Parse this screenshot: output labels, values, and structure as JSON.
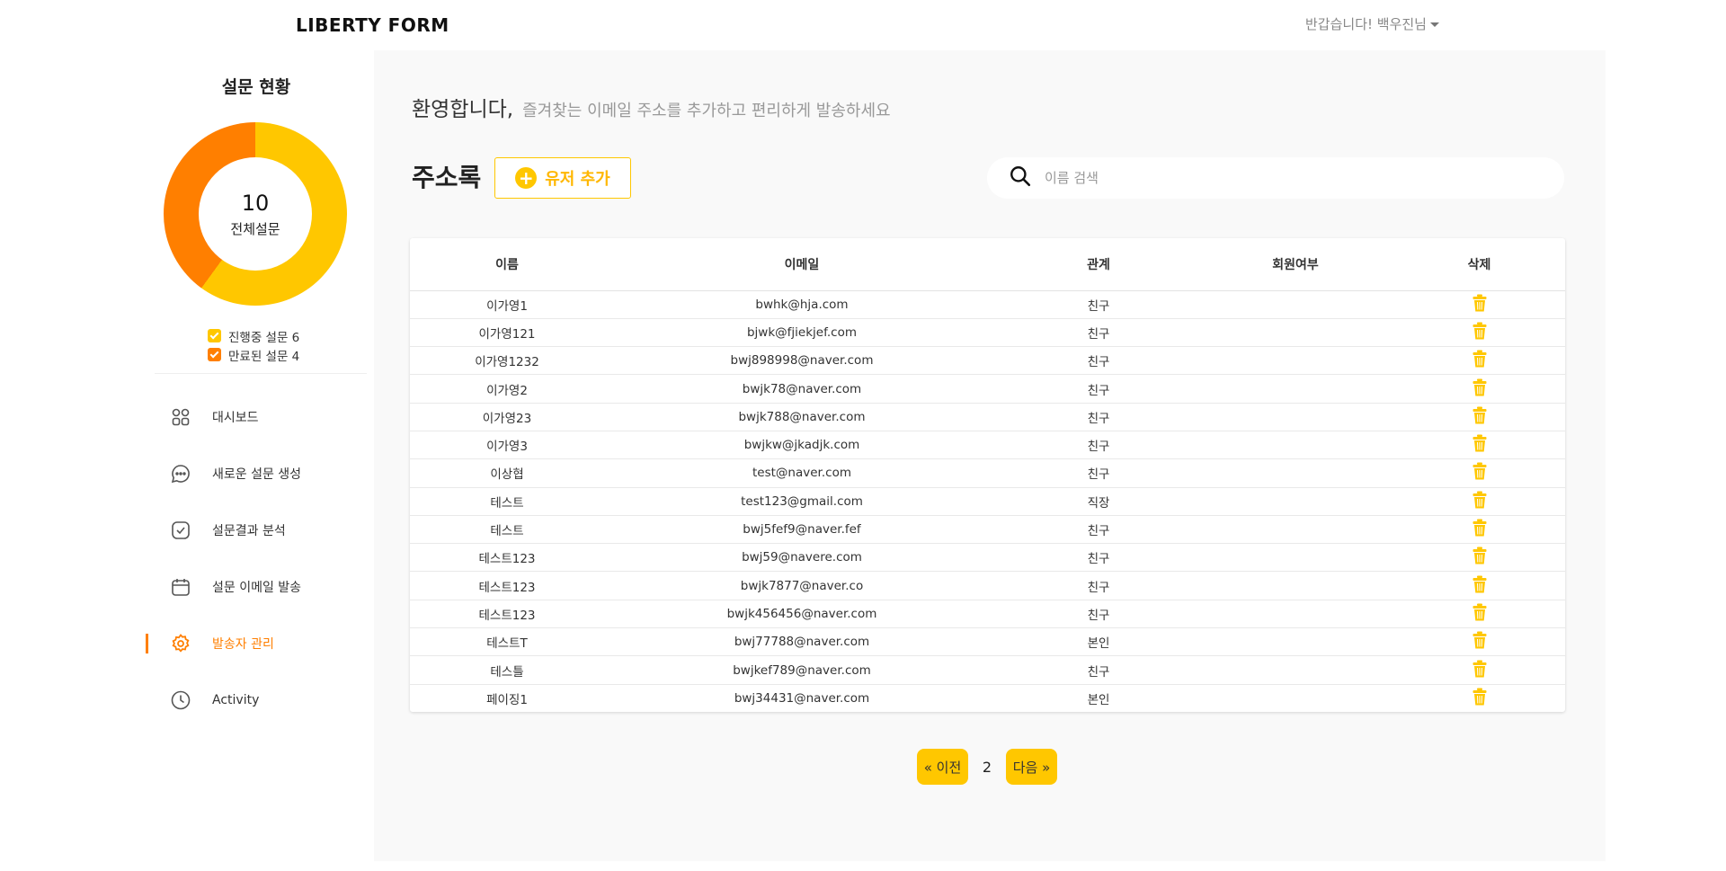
{
  "header": {
    "logo": "LIBERTY FORM",
    "user_greeting": "반갑습니다! 백우진님"
  },
  "sidebar": {
    "status_title": "설문 현황",
    "donut": {
      "total": "10",
      "caption": "전체설문",
      "segments": [
        {
          "label": "진행중 설문",
          "value": 6,
          "color": "#ffc700"
        },
        {
          "label": "만료된 설문",
          "value": 4,
          "color": "#ff7f00"
        }
      ]
    },
    "legend": [
      {
        "text": "진행중 설문 6",
        "color": "#ffc700"
      },
      {
        "text": "만료된 설문 4",
        "color": "#ff7f00"
      }
    ],
    "nav": [
      {
        "label": "대시보드",
        "icon": "dashboard-icon"
      },
      {
        "label": "새로운 설문 생성",
        "icon": "chat-icon"
      },
      {
        "label": "설문결과 분석",
        "icon": "check-square-icon"
      },
      {
        "label": "설문 이메일 발송",
        "icon": "calendar-icon"
      },
      {
        "label": "발송자 관리",
        "icon": "gear-icon",
        "active": true
      },
      {
        "label": "Activity",
        "icon": "clock-icon"
      }
    ]
  },
  "main": {
    "welcome_title": "환영합니다,",
    "welcome_sub": "즐겨찾는 이메일 주소를 추가하고 편리하게 발송하세요",
    "address_book_title": "주소록",
    "add_user_label": "유저 추가",
    "search_placeholder": "이름 검색",
    "table": {
      "headers": [
        "이름",
        "이메일",
        "관계",
        "회원여부",
        "삭제"
      ],
      "rows": [
        [
          "이가영1",
          "bwhk@hja.com",
          "친구",
          ""
        ],
        [
          "이가영121",
          "bjwk@fjiekjef.com",
          "친구",
          ""
        ],
        [
          "이가영1232",
          "bwj898998@naver.com",
          "친구",
          ""
        ],
        [
          "이가영2",
          "bwjk78@naver.com",
          "친구",
          ""
        ],
        [
          "이가영23",
          "bwjk788@naver.com",
          "친구",
          ""
        ],
        [
          "이가영3",
          "bwjkw@jkadjk.com",
          "친구",
          ""
        ],
        [
          "이상협",
          "test@naver.com",
          "친구",
          ""
        ],
        [
          "테스트",
          "test123@gmail.com",
          "직장",
          ""
        ],
        [
          "테스트",
          "bwj5fef9@naver.fef",
          "친구",
          ""
        ],
        [
          "테스트123",
          "bwj59@navere.com",
          "친구",
          ""
        ],
        [
          "테스트123",
          "bwjk7877@naver.co",
          "친구",
          ""
        ],
        [
          "테스트123",
          "bwjk456456@naver.com",
          "친구",
          ""
        ],
        [
          "테스트T",
          "bwj77788@naver.com",
          "본인",
          ""
        ],
        [
          "테스틀",
          "bwjkef789@naver.com",
          "친구",
          ""
        ],
        [
          "페이징1",
          "bwj34431@naver.com",
          "본인",
          ""
        ]
      ]
    },
    "pagination": {
      "prev": "« 이전",
      "current": "2",
      "next": "다음 »"
    }
  },
  "colors": {
    "accent_yellow": "#ffc700",
    "accent_orange": "#ff7f00"
  }
}
